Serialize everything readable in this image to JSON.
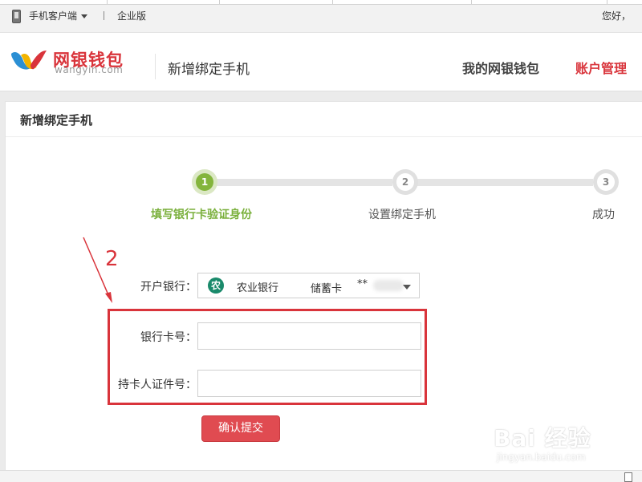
{
  "topbar": {
    "mobile_client": "手机客户端",
    "enterprise": "企业版",
    "greeting": "您好，"
  },
  "header": {
    "logo_text": "网银钱包",
    "logo_sub": "wangyin.com",
    "page_title": "新增绑定手机",
    "nav": [
      {
        "label": "我的网银钱包",
        "active": false
      },
      {
        "label": "账户管理",
        "active": true
      }
    ]
  },
  "panel": {
    "title": "新增绑定手机"
  },
  "steps": [
    {
      "number": "1",
      "label": "填写银行卡验证身份",
      "active": true
    },
    {
      "number": "2",
      "label": "设置绑定手机",
      "active": false
    },
    {
      "number": "3",
      "label": "成功",
      "active": false
    }
  ],
  "form": {
    "bank_label": "开户银行：",
    "bank_name": "农业银行",
    "card_type": "储蓄卡",
    "card_mask": "**",
    "card_number_label": "银行卡号：",
    "card_number_value": "",
    "id_number_label": "持卡人证件号：",
    "id_number_value": "",
    "submit_label": "确认提交"
  },
  "annotation": {
    "number": "2"
  },
  "watermark": {
    "main": "Bai 经验",
    "sub": "jingyan.baidu.com"
  },
  "colors": {
    "accent_red": "#d9343b",
    "step_green": "#84b53c"
  }
}
